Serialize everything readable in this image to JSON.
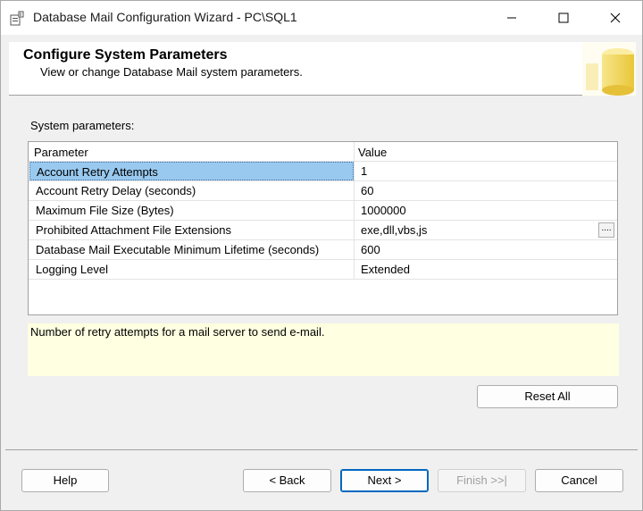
{
  "window": {
    "title": "Database Mail Configuration Wizard - PC\\SQL1"
  },
  "header": {
    "title": "Configure System Parameters",
    "subtitle": "View or change Database Mail system parameters."
  },
  "main": {
    "section_label": "System parameters:",
    "grid": {
      "columns": [
        "Parameter",
        "Value"
      ],
      "rows": [
        {
          "parameter": "Account Retry Attempts",
          "value": "1"
        },
        {
          "parameter": "Account Retry Delay (seconds)",
          "value": "60"
        },
        {
          "parameter": "Maximum File Size (Bytes)",
          "value": "1000000"
        },
        {
          "parameter": "Prohibited Attachment File Extensions",
          "value": "exe,dll,vbs,js"
        },
        {
          "parameter": "Database Mail Executable Minimum Lifetime (seconds)",
          "value": "600"
        },
        {
          "parameter": "Logging Level",
          "value": "Extended"
        }
      ],
      "selected_row": 0,
      "ellipsis_label": "...."
    },
    "description": "Number of retry attempts for a mail server to send e-mail.",
    "reset_label": "Reset All"
  },
  "footer": {
    "help_label": "Help",
    "back_label": "< Back",
    "next_label": "Next >",
    "finish_label": "Finish >>|",
    "cancel_label": "Cancel"
  },
  "colors": {
    "selection": "#99c9ef",
    "description_bg": "#ffffe1",
    "primary_border": "#0067c0"
  },
  "icons": [
    "app-icon",
    "minimize-icon",
    "maximize-icon",
    "close-icon",
    "database-header-graphic"
  ]
}
